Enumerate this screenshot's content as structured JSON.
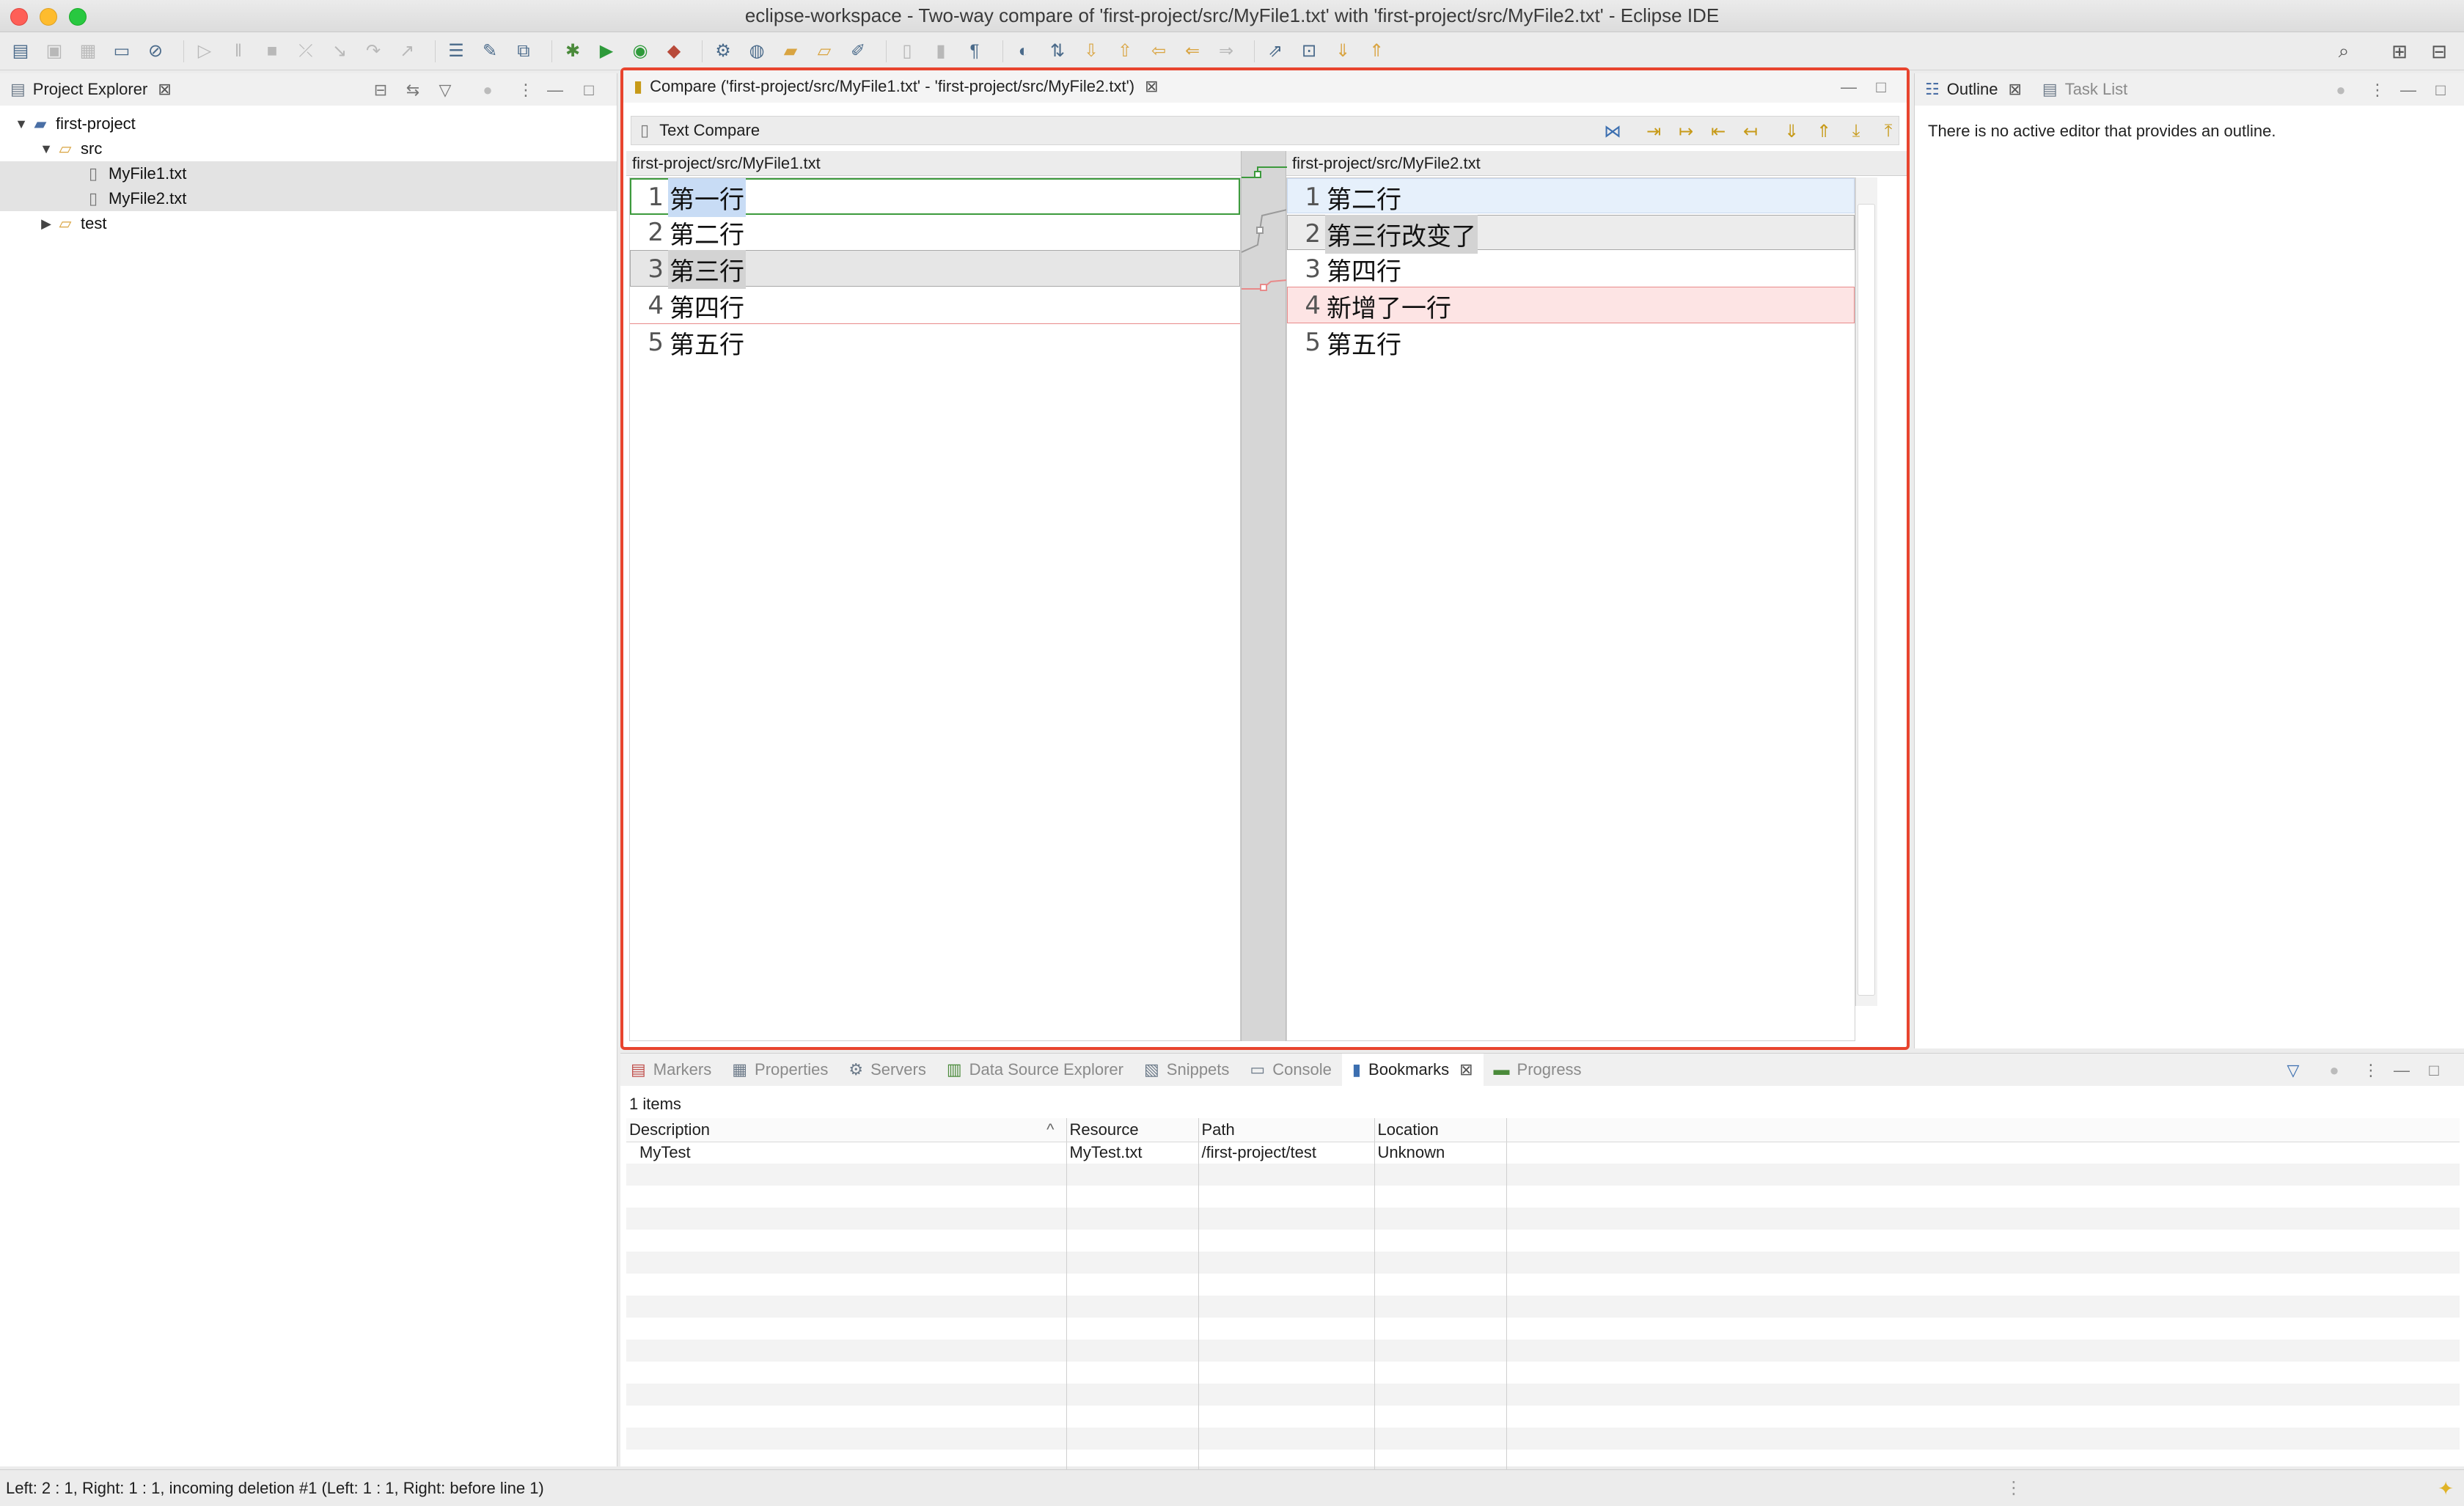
{
  "window": {
    "title": "eclipse-workspace - Two-way compare of 'first-project/src/MyFile1.txt' with 'first-project/src/MyFile2.txt' - Eclipse IDE"
  },
  "project_explorer": {
    "tab_label": "Project Explorer",
    "tree": [
      {
        "label": "first-project",
        "level": 0,
        "type": "project",
        "expanded": true
      },
      {
        "label": "src",
        "level": 1,
        "type": "folder",
        "expanded": true
      },
      {
        "label": "MyFile1.txt",
        "level": 2,
        "type": "file",
        "selected": true
      },
      {
        "label": "MyFile2.txt",
        "level": 2,
        "type": "file",
        "selected": true
      },
      {
        "label": "test",
        "level": 1,
        "type": "folder",
        "expanded": false
      }
    ]
  },
  "compare_editor": {
    "tab_label": "Compare ('first-project/src/MyFile1.txt' - 'first-project/src/MyFile2.txt')",
    "toolbar_label": "Text Compare",
    "left_header": "first-project/src/MyFile1.txt",
    "right_header": "first-project/src/MyFile2.txt",
    "left_lines": [
      {
        "num": "1",
        "text": "第一行"
      },
      {
        "num": "2",
        "text": "第二行"
      },
      {
        "num": "3",
        "text": "第三行"
      },
      {
        "num": "4",
        "text": "第四行"
      },
      {
        "num": "5",
        "text": "第五行"
      }
    ],
    "right_lines": [
      {
        "num": "1",
        "text": "第二行"
      },
      {
        "num": "2",
        "text": "第三行改变了"
      },
      {
        "num": "3",
        "text": "第四行"
      },
      {
        "num": "4",
        "text": "新增了一行"
      },
      {
        "num": "5",
        "text": "第五行"
      }
    ],
    "colors": {
      "highlight": "#4a90e2",
      "outgoing": "#3c9a3c",
      "changed": "#9a9a9a",
      "incoming_red": "#e88a8a"
    }
  },
  "outline": {
    "tab_label": "Outline",
    "task_list_label": "Task List",
    "message": "There is no active editor that provides an outline."
  },
  "bottom_panel": {
    "tabs": [
      "Markers",
      "Properties",
      "Servers",
      "Data Source Explorer",
      "Snippets",
      "Console",
      "Bookmarks",
      "Progress"
    ],
    "active_tab": "Bookmarks",
    "items_count": "1 items",
    "columns": [
      "Description",
      "Resource",
      "Path",
      "Location"
    ],
    "rows": [
      [
        "MyTest",
        "MyTest.txt",
        "/first-project/test",
        "Unknown"
      ]
    ]
  },
  "status": {
    "text": "Left: 2 : 1, Right: 1 : 1, incoming deletion #1 (Left: 1 : 1, Right: before line 1)"
  },
  "accent_color": "#e8442e"
}
